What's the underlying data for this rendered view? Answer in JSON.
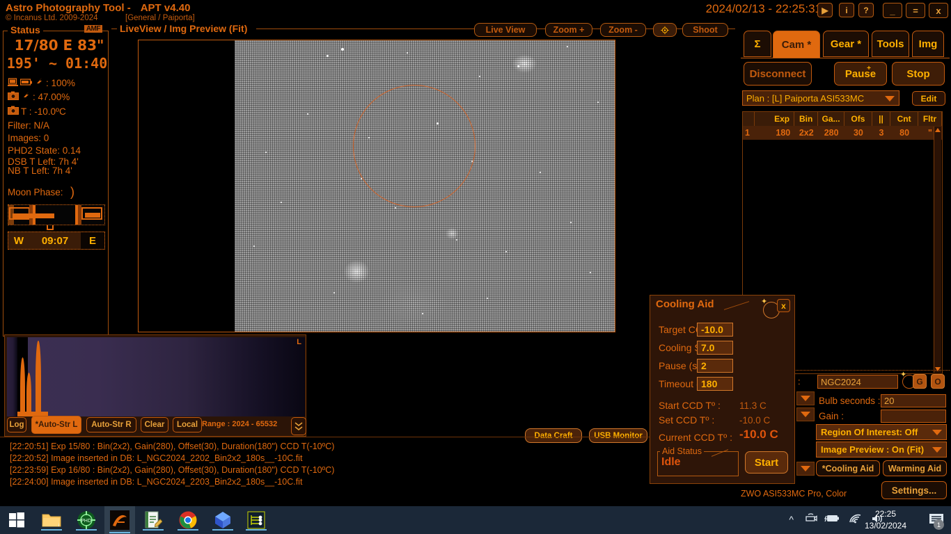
{
  "header": {
    "app_title": "Astro Photography Tool  -",
    "version": "APT v4.40",
    "copyright": "© Incanus Ltd. 2009-2024",
    "location": "[General / Paiporta]",
    "clock": "2024/02/13 - 22:25:31",
    "buttons": {
      "play": "▶",
      "info": "i",
      "help": "?",
      "minimize": "_",
      "restore": "=",
      "close": "x"
    }
  },
  "status": {
    "title": "Status",
    "badge": "AMF",
    "line1": "17/80 E 83\"",
    "line2": "195'  ~  01:40",
    "rows": [
      {
        "icon": "computer-battery-icon",
        "label": ": 100%"
      },
      {
        "icon": "camera-battery-icon",
        "label": ": 47.00%"
      },
      {
        "icon": "camera-temp-icon",
        "label": "T :  -10.0ºC"
      }
    ],
    "filter": "Filter: N/A",
    "images": "Images: 0",
    "phd2": "PHD2 State: 0.14",
    "dsb_left": "DSB T Left: 7h 4'",
    "nb_left": "NB T Left: 7h 4'",
    "moon_phase_label": "Moon Phase:",
    "moon_glyph": ")",
    "time_bar": {
      "west": "W",
      "time": "09:07",
      "east": "E"
    }
  },
  "liveview": {
    "title": "LiveView / Img Preview (Fit)",
    "toolbar": [
      {
        "name": "live-view",
        "label": "Live View",
        "selected": false
      },
      {
        "name": "zoom-in",
        "label": "Zoom +",
        "selected": false
      },
      {
        "name": "zoom-out",
        "label": "Zoom -",
        "selected": false
      },
      {
        "name": "crosshair",
        "label": "⊕",
        "selected": true
      },
      {
        "name": "shoot",
        "label": "Shoot",
        "selected": false
      }
    ]
  },
  "histogram": {
    "buttons": [
      {
        "name": "log",
        "label": "Log",
        "active": false
      },
      {
        "name": "auto-str-l",
        "label": "*Auto-Str L",
        "active": true
      },
      {
        "name": "auto-str-r",
        "label": "Auto-Str R",
        "active": false
      },
      {
        "name": "clear",
        "label": "Clear",
        "active": false
      },
      {
        "name": "local",
        "label": "Local",
        "active": false
      }
    ],
    "range": "Range : 2024 - 65532",
    "channel_label": "L",
    "expand": "»"
  },
  "mid_buttons": [
    {
      "name": "data-craft",
      "label": "Data Craft"
    },
    {
      "name": "usb-monitor",
      "label": "USB Monitor"
    }
  ],
  "log_lines": [
    "[22:20:51] Exp 15/80 : Bin(2x2), Gain(280), Offset(30), Duration(180\") CCD T(-10ºC)",
    "[22:20:52] Image inserted in DB: L_NGC2024_2202_Bin2x2_180s__-10C.fit",
    "[22:23:59] Exp 16/80 : Bin(2x2), Gain(280), Offset(30), Duration(180\") CCD T(-10ºC)",
    "[22:24:00] Image inserted in DB: L_NGC2024_2203_Bin2x2_180s__-10C.fit"
  ],
  "right_panel": {
    "tabs": [
      {
        "name": "sigma",
        "label": "Σ",
        "active": false
      },
      {
        "name": "cam",
        "label": "Cam *",
        "active": true
      },
      {
        "name": "gear",
        "label": "Gear *",
        "active": false
      },
      {
        "name": "tools",
        "label": "Tools",
        "active": false
      },
      {
        "name": "img",
        "label": "Img",
        "active": false
      }
    ],
    "disconnect": "Disconnect",
    "pause": "Pause",
    "pause_sup": "+",
    "stop": "Stop",
    "plan": "Plan : [L] Paiporta ASI533MC",
    "edit": "Edit",
    "table": {
      "headers": [
        "",
        "Exp",
        "Bin",
        "Ga...",
        "Ofs",
        "||",
        "Cnt",
        "Fltr"
      ],
      "rows": [
        [
          "1",
          "180",
          "2x2",
          "280",
          "30",
          "3",
          "80",
          "\""
        ]
      ]
    },
    "object_label": ":",
    "object_value": "NGC2024",
    "goto_button": "G",
    "object_button": "O",
    "bulb_label": "Bulb seconds :",
    "bulb_value": "20",
    "gain_label": "Gain :",
    "gain_value": "",
    "roi": "Region Of Interest: Off",
    "image_preview": "Image Preview : On (Fit)",
    "cooling_aid_button": "*Cooling Aid",
    "warming_aid_button": "Warming Aid",
    "settings_button": "Settings...",
    "camera_name": "ZWO ASI533MC Pro, Color"
  },
  "cooling_aid": {
    "title": "Cooling Aid",
    "close": "x",
    "fields": [
      {
        "label": "Target CCD Tº :",
        "value": "-10.0"
      },
      {
        "label": "Cooling Step (º) :",
        "value": "7.0"
      },
      {
        "label": "Pause (s) :",
        "value": "2"
      },
      {
        "label": "Timeout (s) :",
        "value": "180"
      }
    ],
    "readouts": [
      {
        "label": "Start CCD Tº :",
        "value": "11.3 C"
      },
      {
        "label": "Set CCD Tº :",
        "value": "-10.0 C"
      },
      {
        "label": "Current CCD Tº :",
        "value": "-10.0 C"
      }
    ],
    "aid_status_title": "Aid Status",
    "aid_status_value": "Idle",
    "start_button": "Start"
  },
  "taskbar": {
    "items": [
      {
        "name": "start-button",
        "icon": "windows-logo-icon"
      },
      {
        "name": "file-explorer",
        "icon": "folder-icon"
      },
      {
        "name": "phd2-guiding",
        "icon": "phd2-icon"
      },
      {
        "name": "apt-app",
        "icon": "apt-icon"
      },
      {
        "name": "notepad",
        "icon": "notepad-icon"
      },
      {
        "name": "chrome",
        "icon": "chrome-icon"
      },
      {
        "name": "diamond-app",
        "icon": "diamond-icon"
      },
      {
        "name": "sequence-app",
        "icon": "sequence-icon"
      }
    ],
    "tray": {
      "chevron": "∧",
      "time": "22:25",
      "date": "13/02/2024",
      "notification_count": "1"
    }
  },
  "colors": {
    "accent": "#e0690f",
    "amber": "#ffb000",
    "panel": "#3a1c08",
    "background": "#000000",
    "taskbar": "#1b2838"
  }
}
